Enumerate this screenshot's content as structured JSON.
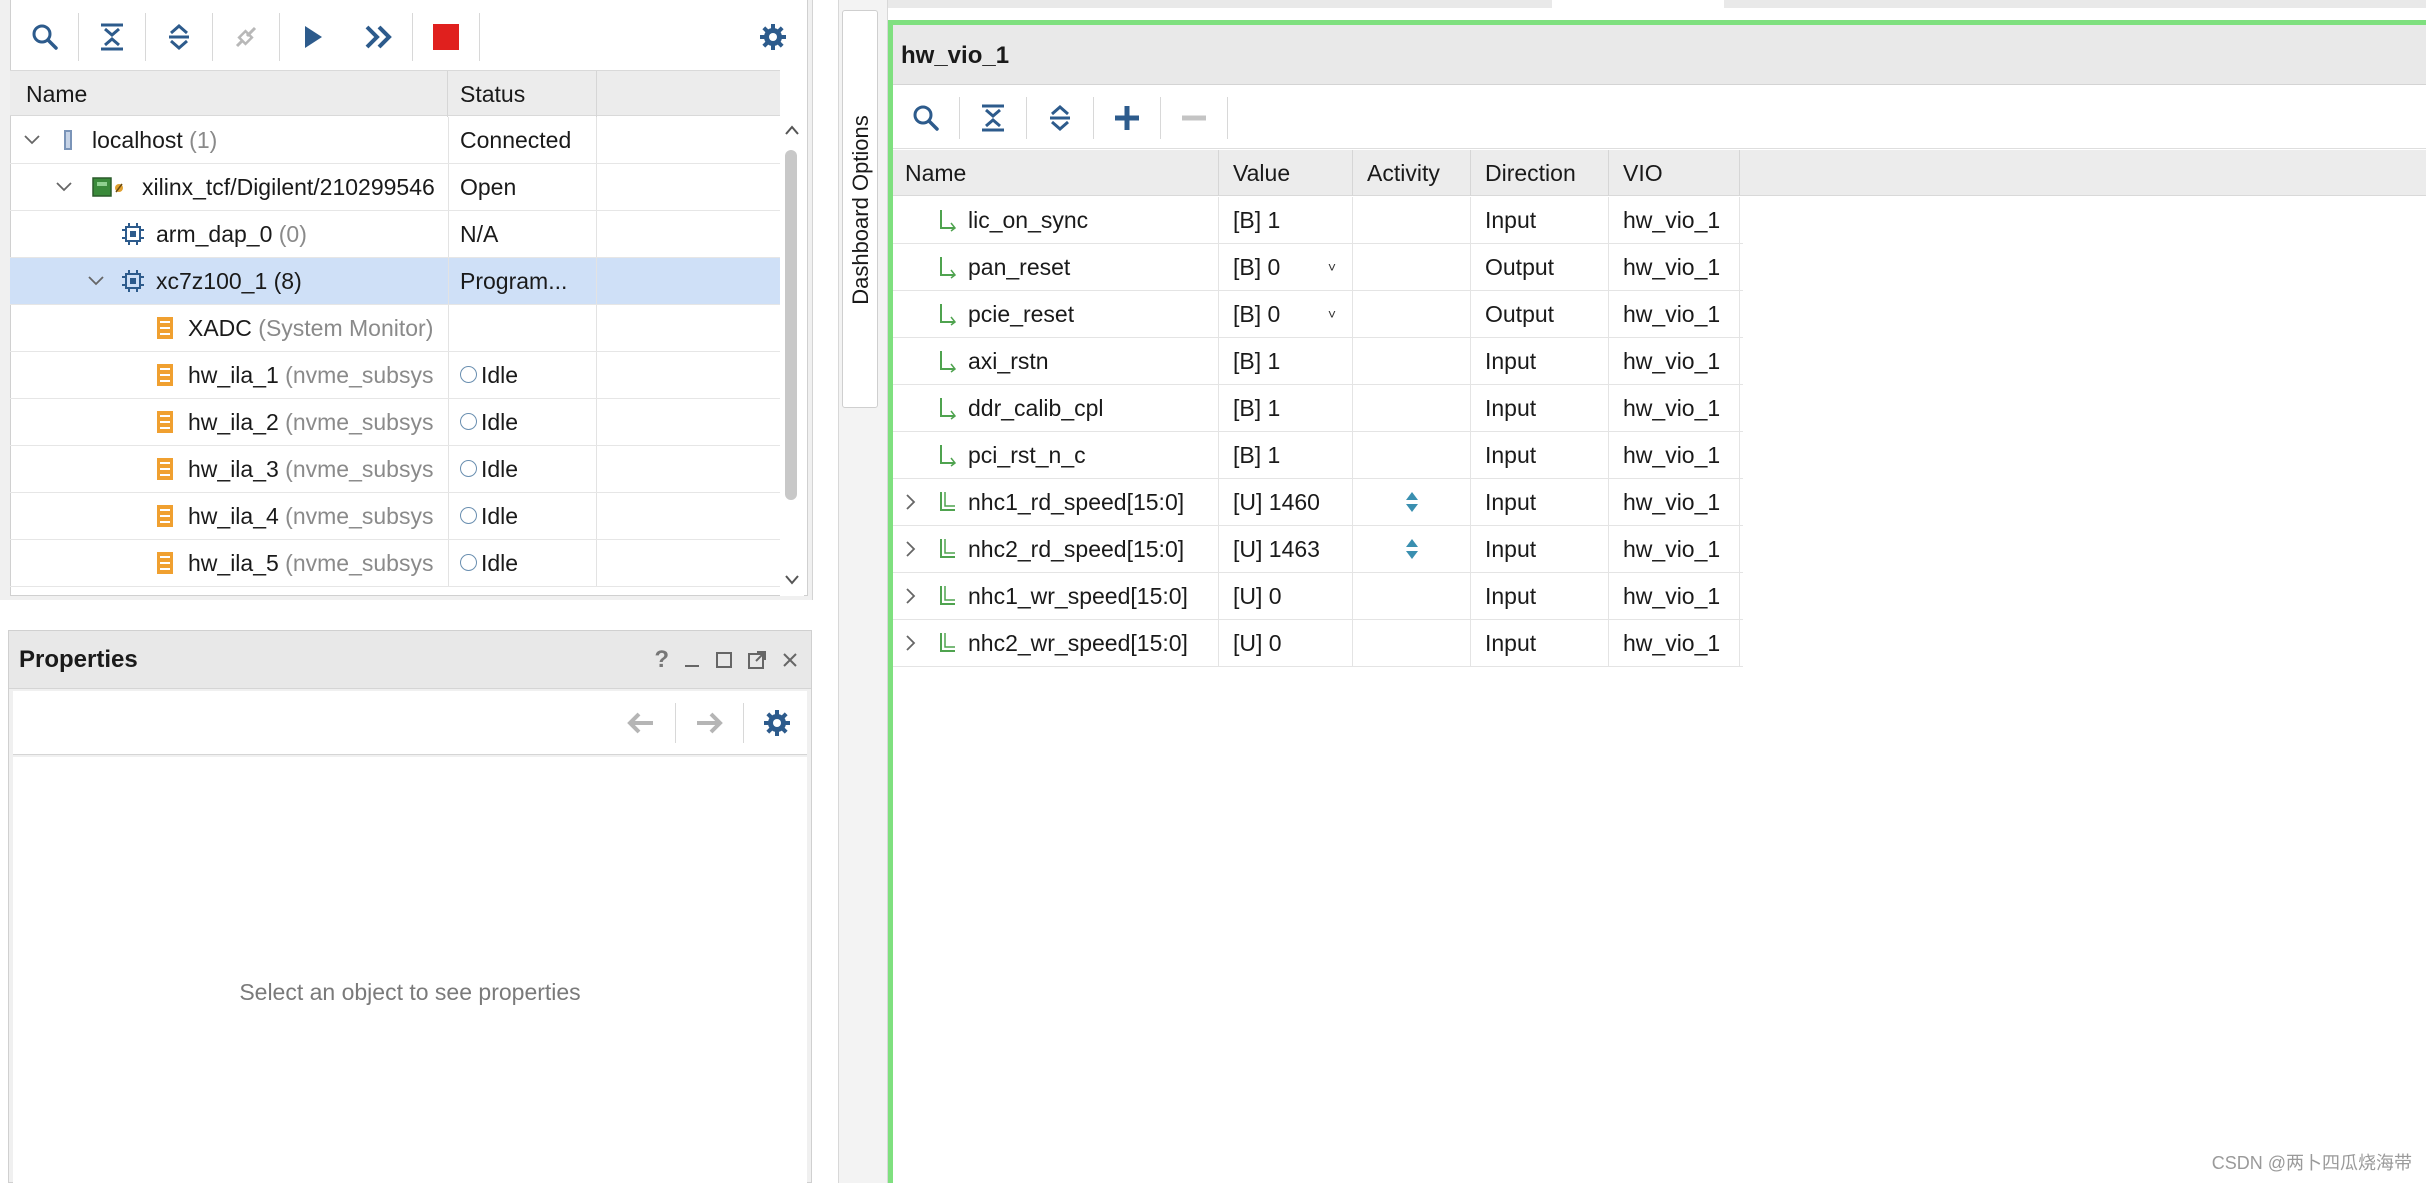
{
  "hardware": {
    "toolbar": [
      {
        "name": "search-icon"
      },
      {
        "name": "collapse-all-icon"
      },
      {
        "name": "expand-all-icon"
      },
      {
        "name": "auto-connect-icon"
      },
      {
        "name": "run-trigger-icon"
      },
      {
        "name": "run-trigger-immediate-icon"
      },
      {
        "name": "stop-trigger-icon"
      },
      {
        "name": "settings-gear-icon"
      }
    ],
    "columns": {
      "name": "Name",
      "status": "Status"
    },
    "rows": [
      {
        "name": "localhost",
        "suffix": " (1)",
        "status": "Connected"
      },
      {
        "name": "xilinx_tcf/Digilent/210299546",
        "suffix": "",
        "status": "Open"
      },
      {
        "name": "arm_dap_0",
        "suffix": " (0)",
        "status": "N/A"
      },
      {
        "name": "xc7z100_1 (8)",
        "suffix": "",
        "status": "Program..."
      },
      {
        "name": "XADC",
        "suffix": " (System Monitor)",
        "status": ""
      },
      {
        "name": "hw_ila_1",
        "suffix": " (nvme_subsys",
        "status": "Idle"
      },
      {
        "name": "hw_ila_2",
        "suffix": " (nvme_subsys",
        "status": "Idle"
      },
      {
        "name": "hw_ila_3",
        "suffix": " (nvme_subsys",
        "status": "Idle"
      },
      {
        "name": "hw_ila_4",
        "suffix": " (nvme_subsys",
        "status": "Idle"
      },
      {
        "name": "hw_ila_5",
        "suffix": " (nvme_subsys",
        "status": "Idle"
      }
    ]
  },
  "properties": {
    "title": "Properties",
    "empty_message": "Select an object to see properties"
  },
  "side_tab": {
    "label": "Dashboard Options"
  },
  "dashboard": {
    "title": "hw_vio_1",
    "columns": {
      "name": "Name",
      "value": "Value",
      "activity": "Activity",
      "direction": "Direction",
      "vio": "VIO"
    },
    "probes": [
      {
        "name": "lic_on_sync",
        "value": "[B] 1",
        "direction": "Input",
        "vio": "hw_vio_1"
      },
      {
        "name": "pan_reset",
        "value": "[B] 0",
        "direction": "Output",
        "vio": "hw_vio_1"
      },
      {
        "name": "pcie_reset",
        "value": "[B] 0",
        "direction": "Output",
        "vio": "hw_vio_1"
      },
      {
        "name": "axi_rstn",
        "value": "[B] 1",
        "direction": "Input",
        "vio": "hw_vio_1"
      },
      {
        "name": "ddr_calib_cpl",
        "value": "[B] 1",
        "direction": "Input",
        "vio": "hw_vio_1"
      },
      {
        "name": "pci_rst_n_c",
        "value": "[B] 1",
        "direction": "Input",
        "vio": "hw_vio_1"
      },
      {
        "name": "nhc1_rd_speed[15:0]",
        "value": "[U] 1460",
        "direction": "Input",
        "vio": "hw_vio_1"
      },
      {
        "name": "nhc2_rd_speed[15:0]",
        "value": "[U] 1463",
        "direction": "Input",
        "vio": "hw_vio_1"
      },
      {
        "name": "nhc1_wr_speed[15:0]",
        "value": "[U] 0",
        "direction": "Input",
        "vio": "hw_vio_1"
      },
      {
        "name": "nhc2_wr_speed[15:0]",
        "value": "[U] 0",
        "direction": "Input",
        "vio": "hw_vio_1"
      }
    ]
  },
  "colors": {
    "accent_blue": "#2d5b8c",
    "highlight_border": "#7fe07f",
    "selected_row": "#cfe0f7",
    "stop_red": "#e0201e",
    "chip_orange": "#f0a030",
    "probe_green": "#4fa34f"
  },
  "watermark": "CSDN @两卜四瓜烧海带"
}
